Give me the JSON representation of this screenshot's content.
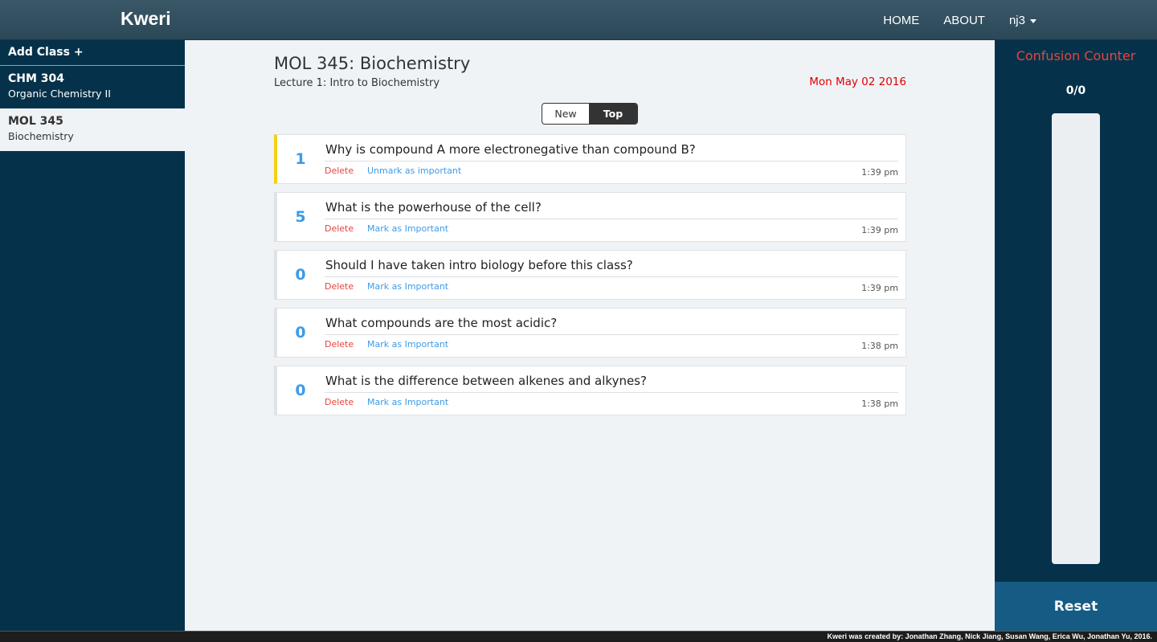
{
  "navbar": {
    "brand": "Kweri",
    "home": "HOME",
    "about": "ABOUT",
    "user": "nj3"
  },
  "sidebar": {
    "add_class": "Add Class +",
    "classes": [
      {
        "code": "CHM 304",
        "name": "Organic Chemistry II",
        "active": false
      },
      {
        "code": "MOL 345",
        "name": "Biochemistry",
        "active": true
      }
    ]
  },
  "main": {
    "course_title": "MOL 345: Biochemistry",
    "lecture_title": "Lecture 1: Intro to Biochemistry",
    "date": "Mon May 02 2016",
    "date_color": "#e00000",
    "sort": {
      "new": "New",
      "top": "Top",
      "selected": "Top"
    },
    "questions": [
      {
        "votes": "1",
        "text": "Why is compound A more electronegative than compound B?",
        "delete": "Delete",
        "mark": "Unmark as important",
        "time": "1:39 pm",
        "important": true
      },
      {
        "votes": "5",
        "text": "What is the powerhouse of the cell?",
        "delete": "Delete",
        "mark": "Mark as Important",
        "time": "1:39 pm",
        "important": false
      },
      {
        "votes": "0",
        "text": "Should I have taken intro biology before this class?",
        "delete": "Delete",
        "mark": "Mark as Important",
        "time": "1:39 pm",
        "important": false
      },
      {
        "votes": "0",
        "text": "What compounds are the most acidic?",
        "delete": "Delete",
        "mark": "Mark as Important",
        "time": "1:38 pm",
        "important": false
      },
      {
        "votes": "0",
        "text": "What is the difference between alkenes and alkynes?",
        "delete": "Delete",
        "mark": "Mark as Important",
        "time": "1:38 pm",
        "important": false
      }
    ]
  },
  "confusion": {
    "title": "Confusion Counter",
    "title_color": "#e5453f",
    "count": "0/0",
    "level": 0,
    "reset": "Reset"
  },
  "footer": {
    "credits": "Kweri was created by: Jonathan Zhang, Nick Jiang, Susan Wang, Erica Wu, Jonathan Yu, 2016."
  }
}
